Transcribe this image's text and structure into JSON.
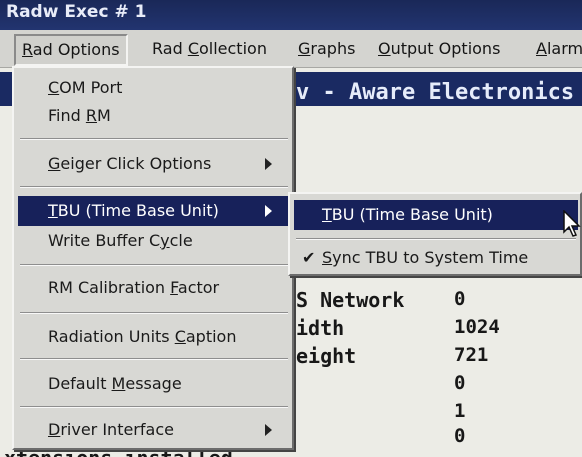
{
  "window": {
    "title": "Radw Exec # 1"
  },
  "menubar": {
    "items": [
      {
        "label": "Rad Options",
        "mnemonic_index": 0
      },
      {
        "label": "Rad Collection",
        "mnemonic_index": 4
      },
      {
        "label": "Graphs",
        "mnemonic_index": 0
      },
      {
        "label": "Output Options",
        "mnemonic_index": 0
      },
      {
        "label": "Alarm",
        "mnemonic_index": 0
      }
    ]
  },
  "content": {
    "banner": "v - Aware Electronics",
    "info_rows": [
      {
        "label": "S Network",
        "value": "0"
      },
      {
        "label": "idth",
        "value": "1024"
      },
      {
        "label": "eight",
        "value": "721"
      },
      {
        "label": "",
        "value": "0"
      },
      {
        "label": "",
        "value": "1"
      },
      {
        "label": "",
        "value": "0"
      }
    ],
    "bottom_line": "xtensions installed"
  },
  "dropdown": {
    "items": [
      {
        "label": "COM Port",
        "mnemonic_index": 0,
        "submenu": false
      },
      {
        "label": "Find RM",
        "mnemonic_index": 5,
        "submenu": false
      },
      {
        "label": "Geiger Click Options",
        "mnemonic_index": 0,
        "submenu": true
      },
      {
        "label": "TBU (Time Base Unit)",
        "mnemonic_index": 0,
        "submenu": true,
        "highlighted": true
      },
      {
        "label": "Write Buffer Cycle",
        "mnemonic_index": 14,
        "submenu": false
      },
      {
        "label": "RM Calibration Factor",
        "mnemonic_index": 15,
        "submenu": false
      },
      {
        "label": "Radiation Units Caption",
        "mnemonic_index": 16,
        "submenu": false
      },
      {
        "label": "Default Message",
        "mnemonic_index": 8,
        "submenu": false
      },
      {
        "label": "Driver Interface",
        "mnemonic_index": 0,
        "submenu": true
      }
    ]
  },
  "submenu": {
    "items": [
      {
        "label": "TBU (Time Base Unit)",
        "mnemonic_index": 0,
        "checked": false,
        "highlighted": true
      },
      {
        "label": "Sync TBU to System Time",
        "mnemonic_index": 0,
        "checked": true
      }
    ]
  },
  "icons": {
    "check": "checkmark-icon",
    "submenu_arrow": "triangle-right-icon",
    "pointer": "mouse-pointer-icon"
  },
  "colors": {
    "highlight_bg": "#17215a",
    "highlight_fg": "#ffffff",
    "menu_bg": "#d8d8d4",
    "banner_bg": "#1a2a62"
  }
}
